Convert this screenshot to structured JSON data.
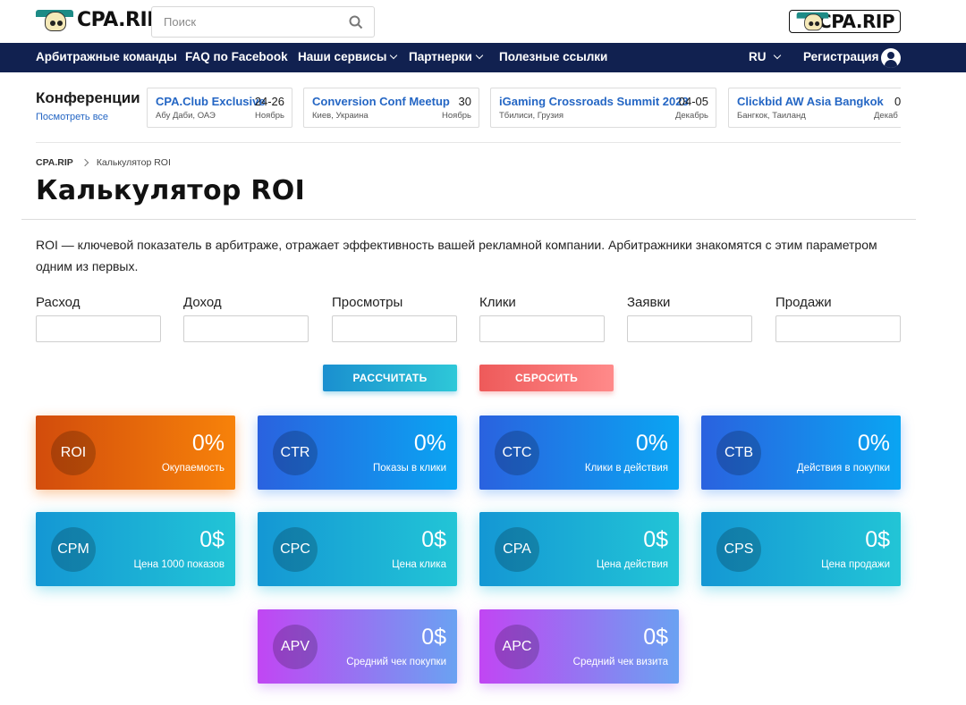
{
  "header": {
    "logo_text": "CPA.RIP",
    "search_placeholder": "Поиск",
    "right_logo_text": "CPA.RIP"
  },
  "nav": {
    "items": [
      {
        "label": "Арбитражные команды",
        "dropdown": false
      },
      {
        "label": "FAQ по Facebook",
        "dropdown": false
      },
      {
        "label": "Наши сервисы",
        "dropdown": true
      },
      {
        "label": "Партнерки",
        "dropdown": true
      },
      {
        "label": "Полезные ссылки",
        "dropdown": false
      }
    ],
    "language": "RU",
    "register_label": "Регистрация"
  },
  "conferences": {
    "title": "Конференции",
    "see_all": "Посмотреть все",
    "cards": [
      {
        "name": "CPA.Club Exclusive",
        "location": "Абу Даби, ОАЭ",
        "dates": "24-26",
        "month": "Ноябрь"
      },
      {
        "name": "Conversion Conf Meetup",
        "location": "Киев, Украина",
        "dates": "30",
        "month": "Ноябрь"
      },
      {
        "name": "iGaming Crossroads Summit 2023",
        "location": "Тбилиси, Грузия",
        "dates": "04-05",
        "month": "Декабрь"
      },
      {
        "name": "Clickbid AW Asia Bangkok",
        "location": "Бангкок, Таиланд",
        "dates": "0",
        "month": "Декаб"
      }
    ]
  },
  "breadcrumb": {
    "home": "CPA.RIP",
    "current": "Калькулятор ROI"
  },
  "page": {
    "title": "Калькулятор ROI",
    "description": "ROI — ключевой показатель в арбитраже, отражает эффективность вашей рекламной компании. Арбитражники знакомятся с этим параметром одним из первых."
  },
  "form": {
    "fields": [
      {
        "label": "Расход",
        "value": ""
      },
      {
        "label": "Доход",
        "value": ""
      },
      {
        "label": "Просмотры",
        "value": ""
      },
      {
        "label": "Клики",
        "value": ""
      },
      {
        "label": "Заявки",
        "value": ""
      },
      {
        "label": "Продажи",
        "value": ""
      }
    ],
    "calc_label": "РАССЧИТАТЬ",
    "reset_label": "СБРОСИТЬ"
  },
  "metrics": [
    {
      "abbr": "ROI",
      "value": "0%",
      "label": "Окупаемость",
      "color": "#f7820a"
    },
    {
      "abbr": "CTR",
      "value": "0%",
      "label": "Показы в клики",
      "color": "#2a62df"
    },
    {
      "abbr": "CTC",
      "value": "0%",
      "label": "Клики в действия",
      "color": "#2a62df"
    },
    {
      "abbr": "CTB",
      "value": "0%",
      "label": "Действия в покупки",
      "color": "#2a62df"
    },
    {
      "abbr": "CPM",
      "value": "0$",
      "label": "Цена 1000 показов",
      "color": "#1497d4"
    },
    {
      "abbr": "CPC",
      "value": "0$",
      "label": "Цена клика",
      "color": "#1497d4"
    },
    {
      "abbr": "CPA",
      "value": "0$",
      "label": "Цена действия",
      "color": "#1497d4"
    },
    {
      "abbr": "CPS",
      "value": "0$",
      "label": "Цена продажи",
      "color": "#1497d4"
    },
    {
      "abbr": "APV",
      "value": "0$",
      "label": "Средний чек покупки",
      "color": "#c146f3"
    },
    {
      "abbr": "APC",
      "value": "0$",
      "label": "Средний чек визита",
      "color": "#c146f3"
    }
  ]
}
